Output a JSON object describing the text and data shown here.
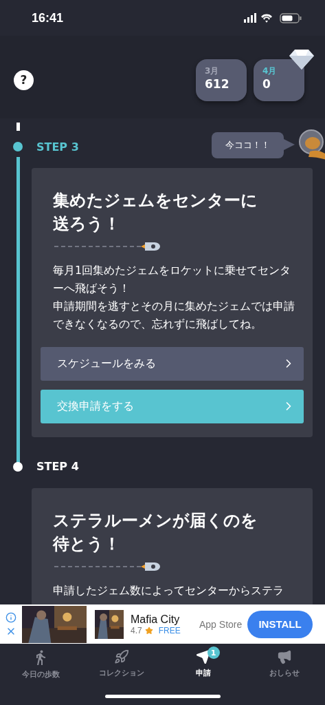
{
  "status_bar": {
    "time": "16:41"
  },
  "header": {
    "help": "?",
    "months": [
      {
        "label": "3月",
        "value": "612",
        "selected": false
      },
      {
        "label": "4月",
        "value": "0",
        "selected": true
      }
    ]
  },
  "steps": [
    {
      "label": "STEP 3",
      "current": true,
      "bubble": "今ココ！！",
      "card": {
        "title": "集めたジェムをセンターに送ろう！",
        "body": [
          "毎月1回集めたジェムをロケットに乗せてセンターへ飛ばそう！",
          "申請期間を逃すとその月に集めたジェムでは申請できなくなるので、忘れずに飛ばしてね。"
        ],
        "buttons": [
          {
            "label": "スケジュールをみる",
            "kind": "secondary"
          },
          {
            "label": "交換申請をする",
            "kind": "primary"
          }
        ]
      }
    },
    {
      "label": "STEP 4",
      "current": false,
      "card": {
        "title": "ステラルーメンが届くのを待とう！",
        "body": [
          "申請したジェム数によってセンターからステラ"
        ]
      }
    }
  ],
  "ad": {
    "app_name": "Mafia City",
    "rating": "4.7",
    "price": "FREE",
    "store": "App Store",
    "button": "INSTALL"
  },
  "tab_bar": [
    {
      "label": "今日の歩数",
      "kind": "walk",
      "selected": false
    },
    {
      "label": "コレクション",
      "kind": "rocket",
      "selected": false
    },
    {
      "label": "申請",
      "kind": "send",
      "selected": true,
      "badge": "1"
    },
    {
      "label": "おしらせ",
      "kind": "megaphone",
      "selected": false
    }
  ]
}
